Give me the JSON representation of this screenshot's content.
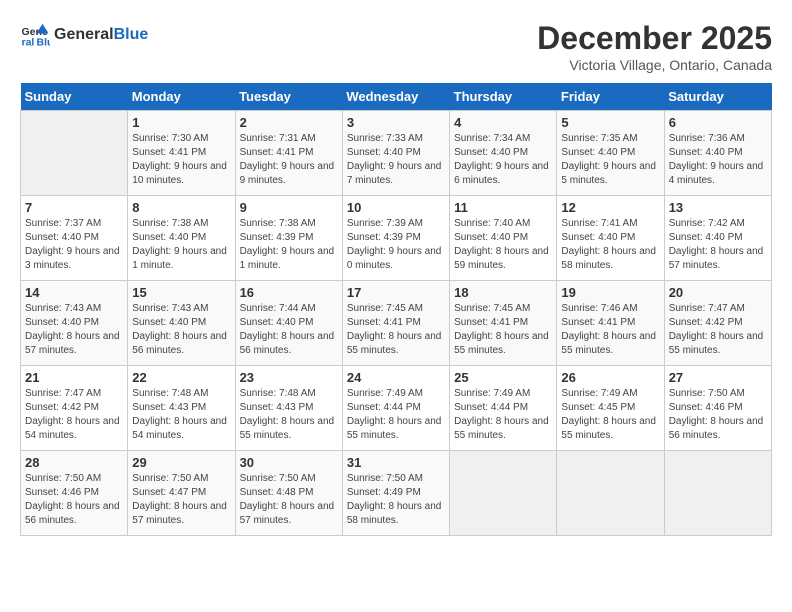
{
  "header": {
    "logo_line1": "General",
    "logo_line2": "Blue",
    "month": "December 2025",
    "location": "Victoria Village, Ontario, Canada"
  },
  "days_of_week": [
    "Sunday",
    "Monday",
    "Tuesday",
    "Wednesday",
    "Thursday",
    "Friday",
    "Saturday"
  ],
  "weeks": [
    [
      {
        "day": "",
        "info": ""
      },
      {
        "day": "1",
        "info": "Sunrise: 7:30 AM\nSunset: 4:41 PM\nDaylight: 9 hours and 10 minutes."
      },
      {
        "day": "2",
        "info": "Sunrise: 7:31 AM\nSunset: 4:41 PM\nDaylight: 9 hours and 9 minutes."
      },
      {
        "day": "3",
        "info": "Sunrise: 7:33 AM\nSunset: 4:40 PM\nDaylight: 9 hours and 7 minutes."
      },
      {
        "day": "4",
        "info": "Sunrise: 7:34 AM\nSunset: 4:40 PM\nDaylight: 9 hours and 6 minutes."
      },
      {
        "day": "5",
        "info": "Sunrise: 7:35 AM\nSunset: 4:40 PM\nDaylight: 9 hours and 5 minutes."
      },
      {
        "day": "6",
        "info": "Sunrise: 7:36 AM\nSunset: 4:40 PM\nDaylight: 9 hours and 4 minutes."
      }
    ],
    [
      {
        "day": "7",
        "info": "Sunrise: 7:37 AM\nSunset: 4:40 PM\nDaylight: 9 hours and 3 minutes."
      },
      {
        "day": "8",
        "info": "Sunrise: 7:38 AM\nSunset: 4:40 PM\nDaylight: 9 hours and 1 minute."
      },
      {
        "day": "9",
        "info": "Sunrise: 7:38 AM\nSunset: 4:39 PM\nDaylight: 9 hours and 1 minute."
      },
      {
        "day": "10",
        "info": "Sunrise: 7:39 AM\nSunset: 4:39 PM\nDaylight: 9 hours and 0 minutes."
      },
      {
        "day": "11",
        "info": "Sunrise: 7:40 AM\nSunset: 4:40 PM\nDaylight: 8 hours and 59 minutes."
      },
      {
        "day": "12",
        "info": "Sunrise: 7:41 AM\nSunset: 4:40 PM\nDaylight: 8 hours and 58 minutes."
      },
      {
        "day": "13",
        "info": "Sunrise: 7:42 AM\nSunset: 4:40 PM\nDaylight: 8 hours and 57 minutes."
      }
    ],
    [
      {
        "day": "14",
        "info": "Sunrise: 7:43 AM\nSunset: 4:40 PM\nDaylight: 8 hours and 57 minutes."
      },
      {
        "day": "15",
        "info": "Sunrise: 7:43 AM\nSunset: 4:40 PM\nDaylight: 8 hours and 56 minutes."
      },
      {
        "day": "16",
        "info": "Sunrise: 7:44 AM\nSunset: 4:40 PM\nDaylight: 8 hours and 56 minutes."
      },
      {
        "day": "17",
        "info": "Sunrise: 7:45 AM\nSunset: 4:41 PM\nDaylight: 8 hours and 55 minutes."
      },
      {
        "day": "18",
        "info": "Sunrise: 7:45 AM\nSunset: 4:41 PM\nDaylight: 8 hours and 55 minutes."
      },
      {
        "day": "19",
        "info": "Sunrise: 7:46 AM\nSunset: 4:41 PM\nDaylight: 8 hours and 55 minutes."
      },
      {
        "day": "20",
        "info": "Sunrise: 7:47 AM\nSunset: 4:42 PM\nDaylight: 8 hours and 55 minutes."
      }
    ],
    [
      {
        "day": "21",
        "info": "Sunrise: 7:47 AM\nSunset: 4:42 PM\nDaylight: 8 hours and 54 minutes."
      },
      {
        "day": "22",
        "info": "Sunrise: 7:48 AM\nSunset: 4:43 PM\nDaylight: 8 hours and 54 minutes."
      },
      {
        "day": "23",
        "info": "Sunrise: 7:48 AM\nSunset: 4:43 PM\nDaylight: 8 hours and 55 minutes."
      },
      {
        "day": "24",
        "info": "Sunrise: 7:49 AM\nSunset: 4:44 PM\nDaylight: 8 hours and 55 minutes."
      },
      {
        "day": "25",
        "info": "Sunrise: 7:49 AM\nSunset: 4:44 PM\nDaylight: 8 hours and 55 minutes."
      },
      {
        "day": "26",
        "info": "Sunrise: 7:49 AM\nSunset: 4:45 PM\nDaylight: 8 hours and 55 minutes."
      },
      {
        "day": "27",
        "info": "Sunrise: 7:50 AM\nSunset: 4:46 PM\nDaylight: 8 hours and 56 minutes."
      }
    ],
    [
      {
        "day": "28",
        "info": "Sunrise: 7:50 AM\nSunset: 4:46 PM\nDaylight: 8 hours and 56 minutes."
      },
      {
        "day": "29",
        "info": "Sunrise: 7:50 AM\nSunset: 4:47 PM\nDaylight: 8 hours and 57 minutes."
      },
      {
        "day": "30",
        "info": "Sunrise: 7:50 AM\nSunset: 4:48 PM\nDaylight: 8 hours and 57 minutes."
      },
      {
        "day": "31",
        "info": "Sunrise: 7:50 AM\nSunset: 4:49 PM\nDaylight: 8 hours and 58 minutes."
      },
      {
        "day": "",
        "info": ""
      },
      {
        "day": "",
        "info": ""
      },
      {
        "day": "",
        "info": ""
      }
    ]
  ]
}
